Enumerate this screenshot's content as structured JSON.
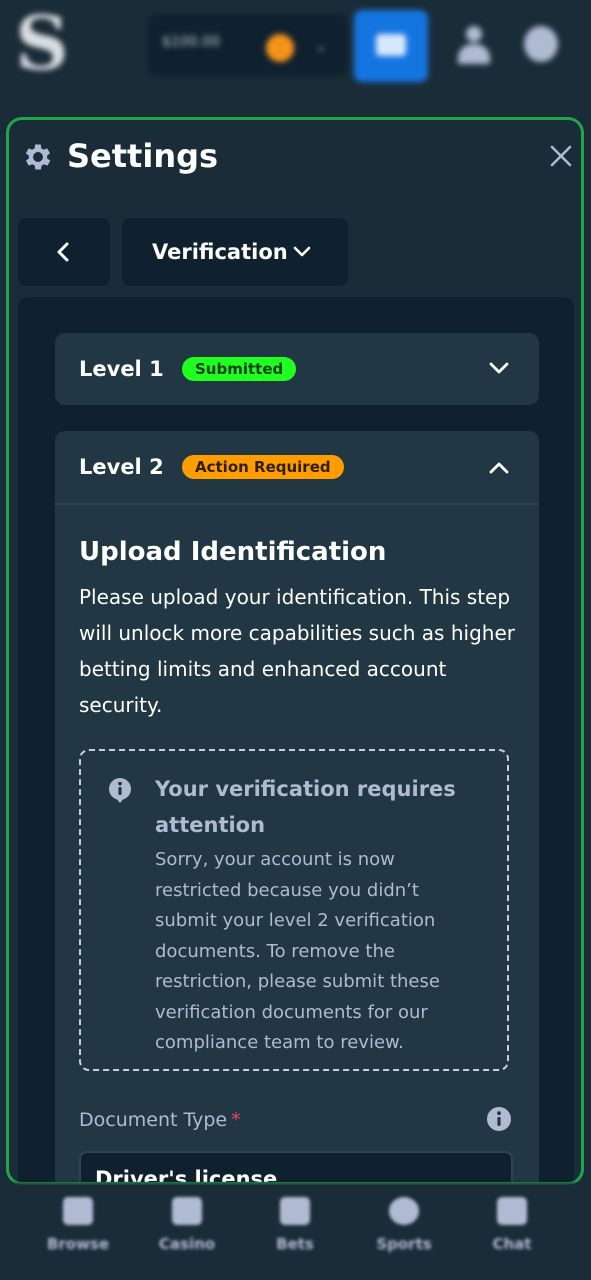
{
  "topbar": {
    "logo": "S",
    "balance_amount": "$100.00",
    "icons": [
      "wallet-icon",
      "user-icon",
      "notification-icon"
    ]
  },
  "modal": {
    "title": "Settings",
    "icons": {
      "title": "gear-icon",
      "close": "close-icon",
      "back": "chevron-left-icon"
    },
    "section_select": "Verification"
  },
  "levels": [
    {
      "title": "Level 1",
      "badge": "Submitted",
      "badge_color": "#1fff20",
      "expanded": false
    },
    {
      "title": "Level 2",
      "badge": "Action Required",
      "badge_color": "#ff9d00",
      "expanded": true
    }
  ],
  "upload": {
    "title": "Upload Identification",
    "description": "Please upload your identification. This step will unlock more capabilities such as higher betting limits and enhanced account security.",
    "notice_title": "Your verification requires attention",
    "notice_body": "Sorry, your account is now restricted because you didn’t submit your level 2 verification documents. To remove the restriction, please submit these verification documents for our compliance team to review.",
    "doc_type_label": "Document Type",
    "required_mark": "*",
    "doc_type_value": "Driver's license"
  },
  "bottom_nav": [
    {
      "label": "Browse",
      "icon": "browse-icon"
    },
    {
      "label": "Casino",
      "icon": "casino-icon"
    },
    {
      "label": "Bets",
      "icon": "bets-icon"
    },
    {
      "label": "Sports",
      "icon": "sports-icon"
    },
    {
      "label": "Chat",
      "icon": "chat-icon"
    }
  ],
  "colors": {
    "background": "#1a2c38",
    "panel": "#0f212e",
    "card": "#213743",
    "accent_border": "#22a447",
    "primary_button": "#1475e1",
    "muted_text": "#b1bad3"
  }
}
